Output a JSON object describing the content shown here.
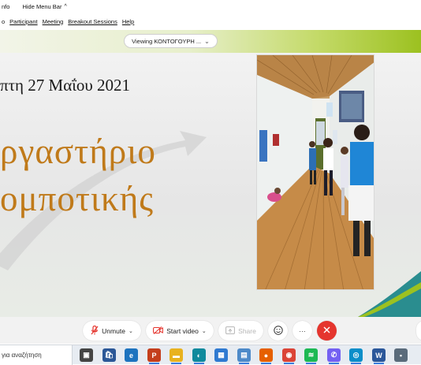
{
  "topbar": {
    "info_label": "nfo",
    "hide_menu_label": "Hide Menu Bar"
  },
  "menu": {
    "items": [
      {
        "label": "o",
        "underline": false
      },
      {
        "label": "Participant",
        "underline": true
      },
      {
        "label": "Meeting",
        "underline": true
      },
      {
        "label": "Breakout Sessions",
        "underline": true
      },
      {
        "label": "Help",
        "underline": true
      }
    ]
  },
  "viewing": {
    "label": "Viewing ΚΟΝΤΟΓΟΥΡΗ ..."
  },
  "slide": {
    "date": "πτη 27 Μαΐου 2021",
    "title_line1": "ργαστήριο",
    "title_line2": "ομποτικής"
  },
  "toolbar": {
    "unmute_label": "Unmute",
    "start_video_label": "Start video",
    "share_label": "Share",
    "more_label": "···"
  },
  "taskbar": {
    "search_text": "για αναζήτηση",
    "apps": [
      {
        "name": "task-view",
        "color": "#444444",
        "glyph": "▣"
      },
      {
        "name": "store",
        "color": "#2b5797",
        "glyph": "🛍"
      },
      {
        "name": "edge-legacy",
        "color": "#1e73be",
        "glyph": "e"
      },
      {
        "name": "powerpoint",
        "color": "#c43e1c",
        "glyph": "P"
      },
      {
        "name": "file-explorer",
        "color": "#e8b21f",
        "glyph": "▬"
      },
      {
        "name": "edge",
        "color": "#0f8a9d",
        "glyph": "◐"
      },
      {
        "name": "photos",
        "color": "#2f7ad1",
        "glyph": "▦"
      },
      {
        "name": "app-grid",
        "color": "#4d8ac9",
        "glyph": "▤"
      },
      {
        "name": "firefox",
        "color": "#e66000",
        "glyph": "●"
      },
      {
        "name": "chrome",
        "color": "#db4437",
        "glyph": "◉"
      },
      {
        "name": "spotify",
        "color": "#1db954",
        "glyph": "≋"
      },
      {
        "name": "viber",
        "color": "#7360f2",
        "glyph": "✆"
      },
      {
        "name": "webex",
        "color": "#0a8ec9",
        "glyph": "◎"
      },
      {
        "name": "word",
        "color": "#2b579a",
        "glyph": "W"
      },
      {
        "name": "app-tail",
        "color": "#5a6b7b",
        "glyph": "▪"
      }
    ]
  },
  "colors": {
    "accent_red": "#e5352e",
    "title_orange": "#c07a1a",
    "band_green": "#9cc120"
  }
}
